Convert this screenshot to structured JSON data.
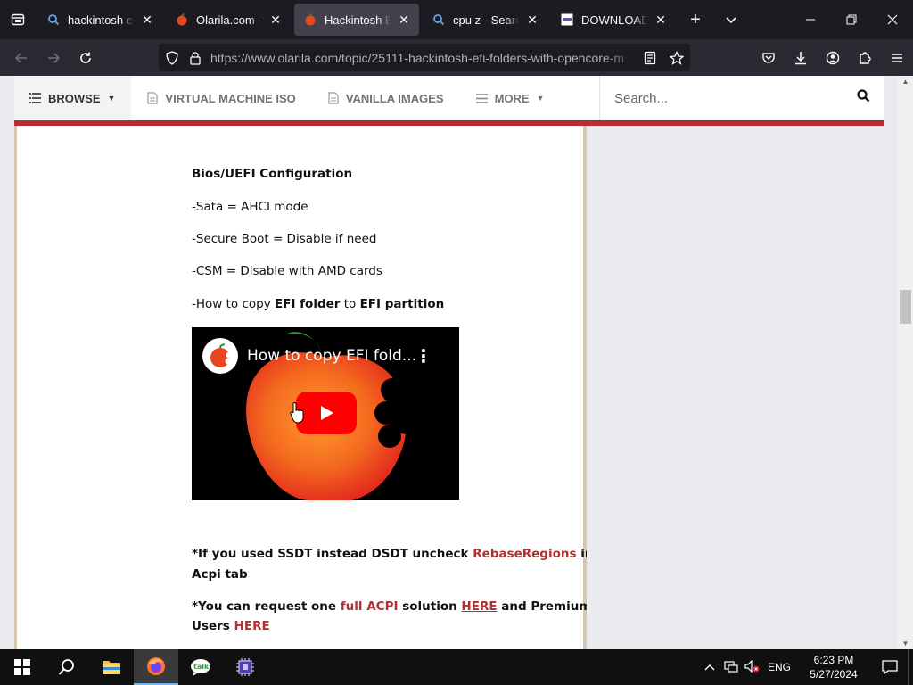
{
  "browser": {
    "tabs": [
      {
        "title": "hackintosh efi - Search",
        "icon": "search-icon",
        "active": false
      },
      {
        "title": "Olarila.com - All in one",
        "icon": "apple-icon",
        "active": false
      },
      {
        "title": "Hackintosh EFI folders",
        "icon": "apple-icon",
        "active": true
      },
      {
        "title": "cpu z - Search",
        "icon": "search-icon",
        "active": false
      },
      {
        "title": "DOWNLOADING",
        "icon": "site-icon",
        "active": false
      }
    ],
    "close_glyph": "✕",
    "new_tab_glyph": "+",
    "url_host": "https://www.olarila.com",
    "url_path": "/topic/25111-hackintosh-efi-folders-with-opencore-m"
  },
  "site": {
    "nav": {
      "browse": "BROWSE",
      "vm_iso": "VIRTUAL MACHINE ISO",
      "vanilla": "VANILLA IMAGES",
      "more": "MORE"
    },
    "search_placeholder": "Search..."
  },
  "article": {
    "heading": "Bios/UEFI Configuration",
    "line_sata": "-Sata = AHCI mode",
    "line_secure_boot": "-Secure Boot = Disable if need",
    "line_csm": "-CSM = Disable with AMD cards",
    "copy_prefix": "-How to copy ",
    "copy_efi_folder": "EFI folder",
    "copy_to": " to ",
    "copy_efi_partition": "EFI partition",
    "video_title": "How to copy EFI fold...",
    "ssdt_prefix": "*If you used SSDT instead DSDT uncheck ",
    "ssdt_link": "RebaseRegions",
    "ssdt_suffix": " in",
    "ssdt_line2": "Acpi tab",
    "request_prefix": "*You can request one ",
    "request_link": "full ACPI",
    "request_mid": " solution ",
    "request_here1": "HERE",
    "request_suffix": " and Premium",
    "users_prefix": "Users ",
    "users_here": "HERE"
  },
  "taskbar": {
    "tray_lang": "ENG",
    "time": "6:23 PM",
    "date": "5/27/2024"
  },
  "colors": {
    "accent_red": "#b2302f",
    "youtube_red": "#ff0000",
    "browser_dark": "#1c1b22"
  }
}
